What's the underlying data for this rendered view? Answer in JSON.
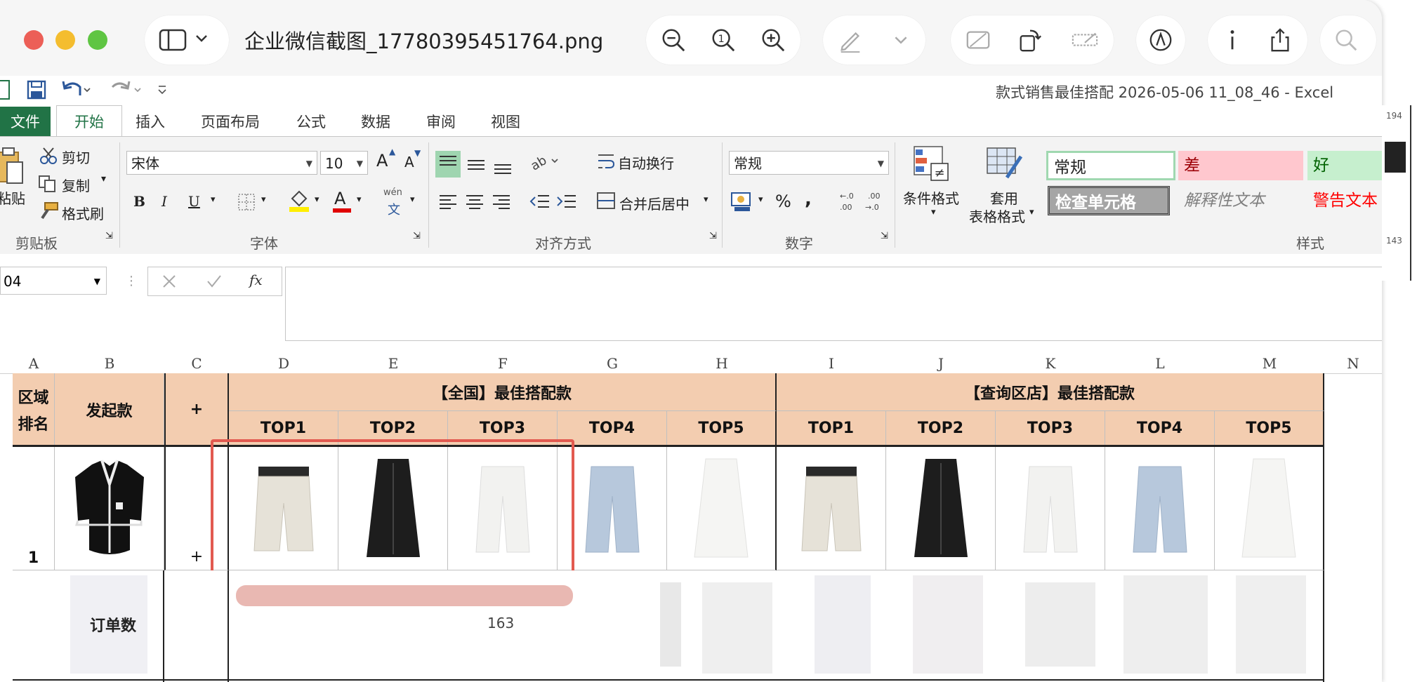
{
  "preview": {
    "filename": "企业微信截图_17780395451764.png"
  },
  "excel": {
    "window_title": "款式销售最佳搭配 2026-05-06 11_08_46 - Excel",
    "tabs": [
      "文件",
      "开始",
      "插入",
      "页面布局",
      "公式",
      "数据",
      "审阅",
      "视图"
    ],
    "clipboard": {
      "paste": "粘贴",
      "cut": "剪切",
      "copy": "复制",
      "format_painter": "格式刷",
      "group": "剪贴板"
    },
    "font": {
      "name": "宋体",
      "size": "10",
      "group": "字体",
      "bold": "B",
      "italic": "I",
      "underline": "U",
      "grow": "A",
      "shrink": "A",
      "color_a": "A",
      "phonetic": "wén",
      "phonetic_char": "文"
    },
    "alignment": {
      "wrap": "自动换行",
      "merge": "合并后居中",
      "group": "对齐方式"
    },
    "number": {
      "format": "常规",
      "percent": "%",
      "comma": ",",
      "group": "数字"
    },
    "styles": {
      "conditional": "条件格式",
      "table_format_1": "套用",
      "table_format_2": "表格格式",
      "normal": "常规",
      "bad": "差",
      "good": "好",
      "check_cell": "检查单元格",
      "explanatory": "解释性文本",
      "warning": "警告文本",
      "group": "样式"
    },
    "namebox": "04",
    "fx": "fx",
    "columns": [
      "A",
      "B",
      "C",
      "D",
      "E",
      "F",
      "G",
      "H",
      "I",
      "J",
      "K",
      "L",
      "M",
      "N"
    ],
    "table": {
      "region_rank_1": "区域",
      "region_rank_2": "排名",
      "origin": "发起款",
      "plus": "+",
      "national_header": "【全国】最佳搭配款",
      "store_header": "【查询区店】最佳搭配款",
      "tops": [
        "TOP1",
        "TOP2",
        "TOP3",
        "TOP4",
        "TOP5",
        "TOP1",
        "TOP2",
        "TOP3",
        "TOP4",
        "TOP5"
      ],
      "row1_rank": "1",
      "row1_plus": "+",
      "partial_label": "订单数",
      "partial_num": "163"
    }
  },
  "side_numbers": [
    "194",
    "143"
  ]
}
